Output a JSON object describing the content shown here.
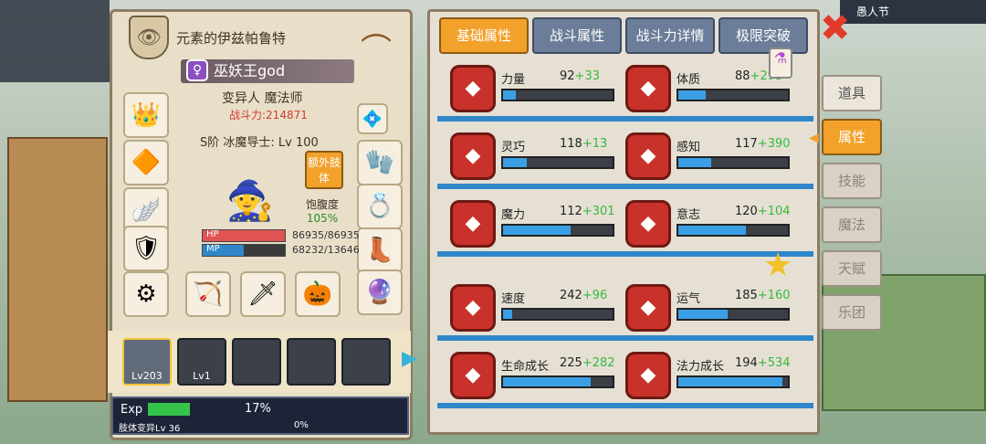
{
  "background_color": "#6b8f6a",
  "header": {
    "title": "元素的伊兹帕鲁特",
    "hanger_icon": "hanger-icon"
  },
  "character": {
    "name": "巫妖王god",
    "gender_symbol": "♀",
    "class": "变异人 魔法师",
    "power": "战斗力:214871",
    "rank": "S阶 冰魔导士: Lv 100",
    "extra_body": "额外肢体",
    "hunger_label": "饱腹度",
    "hunger_value": "105%",
    "hp_label": "HP",
    "hp_value": "86935/86935",
    "hp_fraction": 1.0,
    "mp_label": "MP",
    "mp_value": "68232/13646",
    "mp_fraction": 0.5
  },
  "companions": [
    {
      "label": "Lv203",
      "selected": true
    },
    {
      "label": "Lv1",
      "selected": false
    },
    {
      "label": "",
      "selected": false
    },
    {
      "label": "",
      "selected": false
    },
    {
      "label": "",
      "selected": false
    }
  ],
  "exp": {
    "label": "Exp",
    "percent": "17%",
    "fraction": 0.17,
    "body_label": "肢体变异Lv 36",
    "body_percent": "0%"
  },
  "tabs": [
    "基础属性",
    "战斗属性",
    "战斗力详情",
    "极限突破"
  ],
  "active_tab": 0,
  "stats": [
    {
      "name": "力量",
      "base": "92",
      "bonus": "+33",
      "fill": 0.12,
      "icon": "arm-icon"
    },
    {
      "name": "体质",
      "base": "88",
      "bonus": "+293",
      "fill": 0.25,
      "icon": "muscle-icon"
    },
    {
      "name": "灵巧",
      "base": "118",
      "bonus": "+13",
      "fill": 0.22,
      "icon": "runner-icon"
    },
    {
      "name": "感知",
      "base": "117",
      "bonus": "+390",
      "fill": 0.3,
      "icon": "eye-icon"
    },
    {
      "name": "魔力",
      "base": "112",
      "bonus": "+301",
      "fill": 0.62,
      "icon": "swirl-icon"
    },
    {
      "name": "意志",
      "base": "120",
      "bonus": "+104",
      "fill": 0.62,
      "icon": "fist-icon"
    },
    {
      "name": "速度",
      "base": "242",
      "bonus": "+96",
      "fill": 0.08,
      "icon": "wing-icon"
    },
    {
      "name": "运气",
      "base": "185",
      "bonus": "+160",
      "fill": 0.45,
      "icon": "clover-icon"
    },
    {
      "name": "生命成长",
      "base": "225",
      "bonus": "+282",
      "fill": 0.8,
      "icon": "heart-icon"
    },
    {
      "name": "法力成长",
      "base": "194",
      "bonus": "+534",
      "fill": 0.95,
      "icon": "mana-icon"
    }
  ],
  "side_tabs": [
    "道具",
    "属性",
    "技能",
    "魔法",
    "天赋",
    "乐团"
  ],
  "active_side_tab": 1,
  "top_right_text": "愚人节",
  "colors": {
    "accent": "#f2a12a",
    "bar": "#3b9fe6",
    "bonus": "#35b93d",
    "power": "#d23b2b"
  }
}
